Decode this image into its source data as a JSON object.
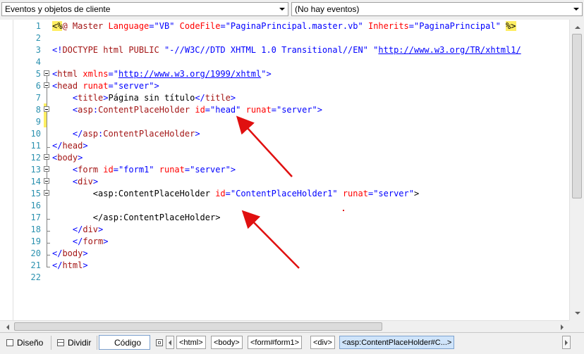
{
  "toolbar": {
    "client_objects_select": "Eventos y objetos de cliente",
    "events_select": "(No hay eventos)"
  },
  "editor": {
    "lines": [
      {
        "n": "1",
        "tokens": [
          [
            "hl",
            "<%"
          ],
          [
            "tg",
            "@ Master "
          ],
          [
            "at",
            "Language"
          ],
          [
            "br",
            "="
          ],
          [
            "vl",
            "\"VB\" "
          ],
          [
            "at",
            "CodeFile"
          ],
          [
            "br",
            "="
          ],
          [
            "vl",
            "\"PaginaPrincipal.master.vb\" "
          ],
          [
            "at",
            "Inherits"
          ],
          [
            "br",
            "="
          ],
          [
            "vl",
            "\"PaginaPrincipal\" "
          ],
          [
            "hl",
            "%>"
          ]
        ]
      },
      {
        "n": "2",
        "tokens": []
      },
      {
        "n": "3",
        "tokens": [
          [
            "br",
            "<!"
          ],
          [
            "tg",
            "DOCTYPE html PUBLIC "
          ],
          [
            "vl",
            "\"-//W3C//DTD XHTML 1.0 Transitional//EN\" \""
          ],
          [
            "lk",
            "http://www.w3.org/TR/xhtml1/"
          ]
        ]
      },
      {
        "n": "4",
        "tokens": []
      },
      {
        "n": "5",
        "tokens": [
          [
            "br",
            "<"
          ],
          [
            "tg",
            "html "
          ],
          [
            "at",
            "xmlns"
          ],
          [
            "br",
            "=\""
          ],
          [
            "lk",
            "http://www.w3.org/1999/xhtml"
          ],
          [
            "br",
            "\">"
          ]
        ]
      },
      {
        "n": "6",
        "tokens": [
          [
            "br",
            "<"
          ],
          [
            "tg",
            "head "
          ],
          [
            "at",
            "runat"
          ],
          [
            "br",
            "="
          ],
          [
            "vl",
            "\"server\""
          ],
          [
            "br",
            ">"
          ]
        ]
      },
      {
        "n": "7",
        "tokens": [
          [
            "tx",
            "    "
          ],
          [
            "br",
            "<"
          ],
          [
            "tg",
            "title"
          ],
          [
            "br",
            ">"
          ],
          [
            "tx",
            "Página sin título"
          ],
          [
            "br",
            "</"
          ],
          [
            "tg",
            "title"
          ],
          [
            "br",
            ">"
          ]
        ]
      },
      {
        "n": "8",
        "tokens": [
          [
            "tx",
            "    "
          ],
          [
            "br",
            "<"
          ],
          [
            "tg",
            "asp"
          ],
          [
            "br",
            ":"
          ],
          [
            "tg",
            "ContentPlaceHolder "
          ],
          [
            "at",
            "id"
          ],
          [
            "br",
            "="
          ],
          [
            "vl",
            "\"head\" "
          ],
          [
            "at",
            "runat"
          ],
          [
            "br",
            "="
          ],
          [
            "vl",
            "\"server\""
          ],
          [
            "br",
            ">"
          ]
        ]
      },
      {
        "n": "9",
        "tokens": []
      },
      {
        "n": "10",
        "tokens": [
          [
            "tx",
            "    "
          ],
          [
            "br",
            "</"
          ],
          [
            "tg",
            "asp"
          ],
          [
            "br",
            ":"
          ],
          [
            "tg",
            "ContentPlaceHolder"
          ],
          [
            "br",
            ">"
          ]
        ]
      },
      {
        "n": "11",
        "tokens": [
          [
            "br",
            "</"
          ],
          [
            "tg",
            "head"
          ],
          [
            "br",
            ">"
          ]
        ]
      },
      {
        "n": "12",
        "tokens": [
          [
            "br",
            "<"
          ],
          [
            "tg",
            "body"
          ],
          [
            "br",
            ">"
          ]
        ]
      },
      {
        "n": "13",
        "tokens": [
          [
            "tx",
            "    "
          ],
          [
            "br",
            "<"
          ],
          [
            "tg",
            "form "
          ],
          [
            "at",
            "id"
          ],
          [
            "br",
            "="
          ],
          [
            "vl",
            "\"form1\" "
          ],
          [
            "at",
            "runat"
          ],
          [
            "br",
            "="
          ],
          [
            "vl",
            "\"server\""
          ],
          [
            "br",
            ">"
          ]
        ]
      },
      {
        "n": "14",
        "tokens": [
          [
            "tx",
            "    "
          ],
          [
            "br",
            "<"
          ],
          [
            "tg",
            "div"
          ],
          [
            "br",
            ">"
          ]
        ]
      },
      {
        "n": "15",
        "tokens": [
          [
            "tx",
            "        <asp:ContentPlaceHolder "
          ],
          [
            "at",
            "id"
          ],
          [
            "br",
            "="
          ],
          [
            "vl",
            "\"ContentPlaceHolder1\" "
          ],
          [
            "at",
            "runat"
          ],
          [
            "br",
            "="
          ],
          [
            "vl",
            "\"server\""
          ],
          [
            "tx",
            ">"
          ]
        ]
      },
      {
        "n": "16",
        "tokens": []
      },
      {
        "n": "17",
        "tokens": [
          [
            "tx",
            "        </asp:ContentPlaceHolder>"
          ]
        ]
      },
      {
        "n": "18",
        "tokens": [
          [
            "tx",
            "    "
          ],
          [
            "br",
            "</"
          ],
          [
            "tg",
            "div"
          ],
          [
            "br",
            ">"
          ]
        ]
      },
      {
        "n": "19",
        "tokens": [
          [
            "tx",
            "    "
          ],
          [
            "br",
            "</"
          ],
          [
            "tg",
            "form"
          ],
          [
            "br",
            ">"
          ]
        ]
      },
      {
        "n": "20",
        "tokens": [
          [
            "br",
            "</"
          ],
          [
            "tg",
            "body"
          ],
          [
            "br",
            ">"
          ]
        ]
      },
      {
        "n": "21",
        "tokens": [
          [
            "br",
            "</"
          ],
          [
            "tg",
            "html"
          ],
          [
            "br",
            ">"
          ]
        ]
      },
      {
        "n": "22",
        "tokens": []
      }
    ]
  },
  "views": {
    "design": "Diseño",
    "split": "Dividir",
    "code": "Código"
  },
  "breadcrumbs": [
    "<html>",
    "<body>",
    "<form#form1>",
    "<div>",
    "<asp:ContentPlaceHolder#C...>"
  ]
}
